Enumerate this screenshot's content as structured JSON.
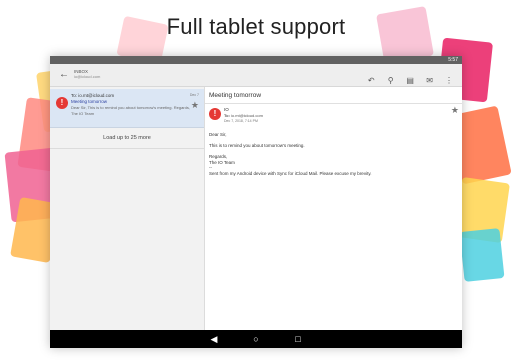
{
  "headline": "Full tablet support",
  "status": {
    "time": "5:57"
  },
  "toolbar": {
    "account_label": "INBOX",
    "account_email": "io@icloud.com",
    "icons": [
      "reply-all-icon",
      "search-icon",
      "delete-icon",
      "mail-icon",
      "overflow-menu-icon"
    ]
  },
  "message_list": {
    "items": [
      {
        "to": "To: io.mt@icloud.com",
        "date": "Dec 7",
        "subject": "Meeting tomorrow",
        "preview": "Dear Sir, This is to remind you about tomorrow's meeting. Regards, The IO Team"
      }
    ],
    "load_more": "Load up to 25 more"
  },
  "reader": {
    "subject": "Meeting tomorrow",
    "from": "IO",
    "to_label": "To:",
    "to": "io.mt@icloud.com",
    "date": "Dec 7, 2018, 7:14 PM",
    "body": [
      "Dear Sir,",
      "",
      "This is to remind you about tomorrow's meeting.",
      "",
      "Regards,",
      "The IO Team",
      "--",
      "Sent from my Android device with Sync for iCloud Mail. Please excuse my brevity."
    ]
  },
  "colors": {
    "accent": "#2a3fa0",
    "alert": "#e53935",
    "selected_row": "#dbe6f4"
  }
}
